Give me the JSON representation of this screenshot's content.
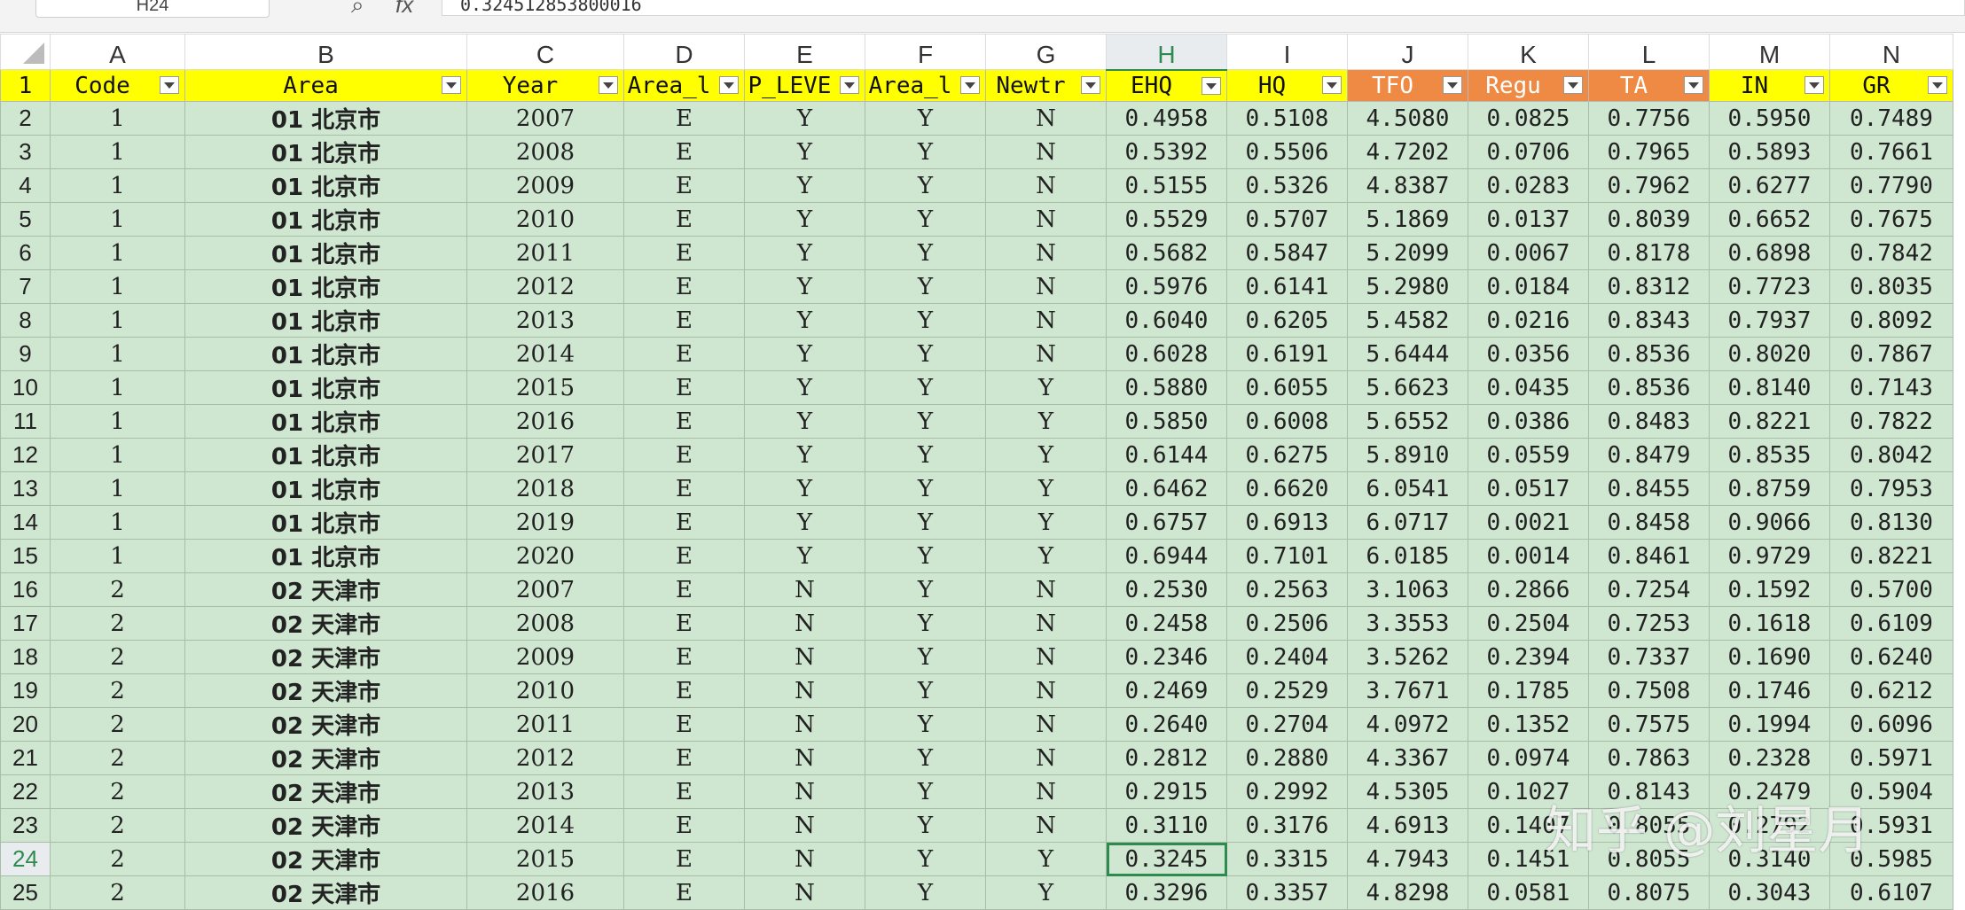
{
  "formula_bar": {
    "name_box": "H24",
    "formula": "0.324512853800016"
  },
  "columns": [
    "A",
    "B",
    "C",
    "D",
    "E",
    "F",
    "G",
    "H",
    "I",
    "J",
    "K",
    "L",
    "M",
    "N"
  ],
  "active_column": "H",
  "active_row": "24",
  "header_row": {
    "row_num": "1",
    "cells": [
      "Code",
      "Area",
      "Year",
      "Area_l",
      "P_LEVE",
      "Area_l",
      "Newtr",
      "EHQ",
      "HQ",
      "TFO",
      "Regu",
      "TA",
      "IN",
      "GR"
    ],
    "orange_columns": [
      "TFO",
      "Regu",
      "TA"
    ]
  },
  "rows": [
    {
      "n": "2",
      "code": "1",
      "area": "01 北京市",
      "year": "2007",
      "d": "E",
      "e": "Y",
      "f": "Y",
      "g": "N",
      "ehq": "0.4958",
      "hq": "0.5108",
      "tfo": "4.5080",
      "regu": "0.0825",
      "ta": "0.7756",
      "in": "0.5950",
      "gr": "0.7489"
    },
    {
      "n": "3",
      "code": "1",
      "area": "01 北京市",
      "year": "2008",
      "d": "E",
      "e": "Y",
      "f": "Y",
      "g": "N",
      "ehq": "0.5392",
      "hq": "0.5506",
      "tfo": "4.7202",
      "regu": "0.0706",
      "ta": "0.7965",
      "in": "0.5893",
      "gr": "0.7661"
    },
    {
      "n": "4",
      "code": "1",
      "area": "01 北京市",
      "year": "2009",
      "d": "E",
      "e": "Y",
      "f": "Y",
      "g": "N",
      "ehq": "0.5155",
      "hq": "0.5326",
      "tfo": "4.8387",
      "regu": "0.0283",
      "ta": "0.7962",
      "in": "0.6277",
      "gr": "0.7790"
    },
    {
      "n": "5",
      "code": "1",
      "area": "01 北京市",
      "year": "2010",
      "d": "E",
      "e": "Y",
      "f": "Y",
      "g": "N",
      "ehq": "0.5529",
      "hq": "0.5707",
      "tfo": "5.1869",
      "regu": "0.0137",
      "ta": "0.8039",
      "in": "0.6652",
      "gr": "0.7675"
    },
    {
      "n": "6",
      "code": "1",
      "area": "01 北京市",
      "year": "2011",
      "d": "E",
      "e": "Y",
      "f": "Y",
      "g": "N",
      "ehq": "0.5682",
      "hq": "0.5847",
      "tfo": "5.2099",
      "regu": "0.0067",
      "ta": "0.8178",
      "in": "0.6898",
      "gr": "0.7842"
    },
    {
      "n": "7",
      "code": "1",
      "area": "01 北京市",
      "year": "2012",
      "d": "E",
      "e": "Y",
      "f": "Y",
      "g": "N",
      "ehq": "0.5976",
      "hq": "0.6141",
      "tfo": "5.2980",
      "regu": "0.0184",
      "ta": "0.8312",
      "in": "0.7723",
      "gr": "0.8035"
    },
    {
      "n": "8",
      "code": "1",
      "area": "01 北京市",
      "year": "2013",
      "d": "E",
      "e": "Y",
      "f": "Y",
      "g": "N",
      "ehq": "0.6040",
      "hq": "0.6205",
      "tfo": "5.4582",
      "regu": "0.0216",
      "ta": "0.8343",
      "in": "0.7937",
      "gr": "0.8092"
    },
    {
      "n": "9",
      "code": "1",
      "area": "01 北京市",
      "year": "2014",
      "d": "E",
      "e": "Y",
      "f": "Y",
      "g": "N",
      "ehq": "0.6028",
      "hq": "0.6191",
      "tfo": "5.6444",
      "regu": "0.0356",
      "ta": "0.8536",
      "in": "0.8020",
      "gr": "0.7867"
    },
    {
      "n": "10",
      "code": "1",
      "area": "01 北京市",
      "year": "2015",
      "d": "E",
      "e": "Y",
      "f": "Y",
      "g": "Y",
      "ehq": "0.5880",
      "hq": "0.6055",
      "tfo": "5.6623",
      "regu": "0.0435",
      "ta": "0.8536",
      "in": "0.8140",
      "gr": "0.7143"
    },
    {
      "n": "11",
      "code": "1",
      "area": "01 北京市",
      "year": "2016",
      "d": "E",
      "e": "Y",
      "f": "Y",
      "g": "Y",
      "ehq": "0.5850",
      "hq": "0.6008",
      "tfo": "5.6552",
      "regu": "0.0386",
      "ta": "0.8483",
      "in": "0.8221",
      "gr": "0.7822"
    },
    {
      "n": "12",
      "code": "1",
      "area": "01 北京市",
      "year": "2017",
      "d": "E",
      "e": "Y",
      "f": "Y",
      "g": "Y",
      "ehq": "0.6144",
      "hq": "0.6275",
      "tfo": "5.8910",
      "regu": "0.0559",
      "ta": "0.8479",
      "in": "0.8535",
      "gr": "0.8042"
    },
    {
      "n": "13",
      "code": "1",
      "area": "01 北京市",
      "year": "2018",
      "d": "E",
      "e": "Y",
      "f": "Y",
      "g": "Y",
      "ehq": "0.6462",
      "hq": "0.6620",
      "tfo": "6.0541",
      "regu": "0.0517",
      "ta": "0.8455",
      "in": "0.8759",
      "gr": "0.7953"
    },
    {
      "n": "14",
      "code": "1",
      "area": "01 北京市",
      "year": "2019",
      "d": "E",
      "e": "Y",
      "f": "Y",
      "g": "Y",
      "ehq": "0.6757",
      "hq": "0.6913",
      "tfo": "6.0717",
      "regu": "0.0021",
      "ta": "0.8458",
      "in": "0.9066",
      "gr": "0.8130"
    },
    {
      "n": "15",
      "code": "1",
      "area": "01 北京市",
      "year": "2020",
      "d": "E",
      "e": "Y",
      "f": "Y",
      "g": "Y",
      "ehq": "0.6944",
      "hq": "0.7101",
      "tfo": "6.0185",
      "regu": "0.0014",
      "ta": "0.8461",
      "in": "0.9729",
      "gr": "0.8221"
    },
    {
      "n": "16",
      "code": "2",
      "area": "02 天津市",
      "year": "2007",
      "d": "E",
      "e": "N",
      "f": "Y",
      "g": "N",
      "ehq": "0.2530",
      "hq": "0.2563",
      "tfo": "3.1063",
      "regu": "0.2866",
      "ta": "0.7254",
      "in": "0.1592",
      "gr": "0.5700"
    },
    {
      "n": "17",
      "code": "2",
      "area": "02 天津市",
      "year": "2008",
      "d": "E",
      "e": "N",
      "f": "Y",
      "g": "N",
      "ehq": "0.2458",
      "hq": "0.2506",
      "tfo": "3.3553",
      "regu": "0.2504",
      "ta": "0.7253",
      "in": "0.1618",
      "gr": "0.6109"
    },
    {
      "n": "18",
      "code": "2",
      "area": "02 天津市",
      "year": "2009",
      "d": "E",
      "e": "N",
      "f": "Y",
      "g": "N",
      "ehq": "0.2346",
      "hq": "0.2404",
      "tfo": "3.5262",
      "regu": "0.2394",
      "ta": "0.7337",
      "in": "0.1690",
      "gr": "0.6240"
    },
    {
      "n": "19",
      "code": "2",
      "area": "02 天津市",
      "year": "2010",
      "d": "E",
      "e": "N",
      "f": "Y",
      "g": "N",
      "ehq": "0.2469",
      "hq": "0.2529",
      "tfo": "3.7671",
      "regu": "0.1785",
      "ta": "0.7508",
      "in": "0.1746",
      "gr": "0.6212"
    },
    {
      "n": "20",
      "code": "2",
      "area": "02 天津市",
      "year": "2011",
      "d": "E",
      "e": "N",
      "f": "Y",
      "g": "N",
      "ehq": "0.2640",
      "hq": "0.2704",
      "tfo": "4.0972",
      "regu": "0.1352",
      "ta": "0.7575",
      "in": "0.1994",
      "gr": "0.6096"
    },
    {
      "n": "21",
      "code": "2",
      "area": "02 天津市",
      "year": "2012",
      "d": "E",
      "e": "N",
      "f": "Y",
      "g": "N",
      "ehq": "0.2812",
      "hq": "0.2880",
      "tfo": "4.3367",
      "regu": "0.0974",
      "ta": "0.7863",
      "in": "0.2328",
      "gr": "0.5971"
    },
    {
      "n": "22",
      "code": "2",
      "area": "02 天津市",
      "year": "2013",
      "d": "E",
      "e": "N",
      "f": "Y",
      "g": "N",
      "ehq": "0.2915",
      "hq": "0.2992",
      "tfo": "4.5305",
      "regu": "0.1027",
      "ta": "0.8143",
      "in": "0.2479",
      "gr": "0.5904"
    },
    {
      "n": "23",
      "code": "2",
      "area": "02 天津市",
      "year": "2014",
      "d": "E",
      "e": "N",
      "f": "Y",
      "g": "N",
      "ehq": "0.3110",
      "hq": "0.3176",
      "tfo": "4.6913",
      "regu": "0.1407",
      "ta": "0.8055",
      "in": "0.2792",
      "gr": "0.5931"
    },
    {
      "n": "24",
      "code": "2",
      "area": "02 天津市",
      "year": "2015",
      "d": "E",
      "e": "N",
      "f": "Y",
      "g": "Y",
      "ehq": "0.3245",
      "hq": "0.3315",
      "tfo": "4.7943",
      "regu": "0.1451",
      "ta": "0.8055",
      "in": "0.3140",
      "gr": "0.5985"
    },
    {
      "n": "25",
      "code": "2",
      "area": "02 天津市",
      "year": "2016",
      "d": "E",
      "e": "N",
      "f": "Y",
      "g": "Y",
      "ehq": "0.3296",
      "hq": "0.3357",
      "tfo": "4.8298",
      "regu": "0.0581",
      "ta": "0.8075",
      "in": "0.3043",
      "gr": "0.6107"
    }
  ],
  "watermark": "知乎 @刘星月",
  "colors": {
    "header_yellow": "#ffff00",
    "header_orange": "#ee8a44",
    "data_green": "#cfe6d1",
    "active_green": "#2f8a4f"
  }
}
